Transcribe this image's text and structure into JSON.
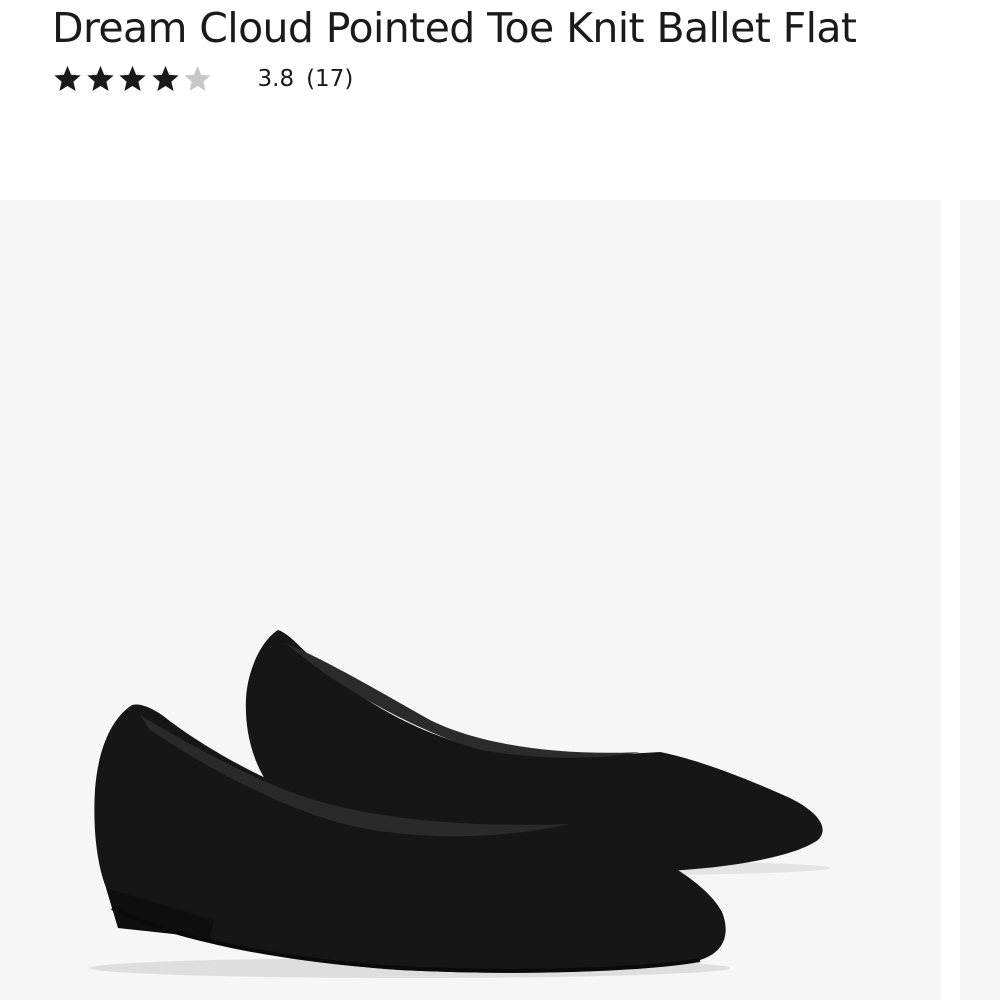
{
  "product": {
    "title": "Dream Cloud Pointed Toe Knit Ballet Flat",
    "rating": {
      "value": 3.8,
      "value_text": "3.8",
      "count_text": "(17)",
      "max_stars": 5,
      "filled_stars": 4
    }
  },
  "gallery": {
    "main_image_icon": "black-knit-ballet-flats-pair",
    "next_image_icon": "product-image-thumbnail"
  },
  "colors": {
    "text": "#1a1a1a",
    "star_filled": "#1a1a1a",
    "star_empty": "#c8c8c8",
    "image_background": "#f6f6f6",
    "shoe": "#161616"
  }
}
